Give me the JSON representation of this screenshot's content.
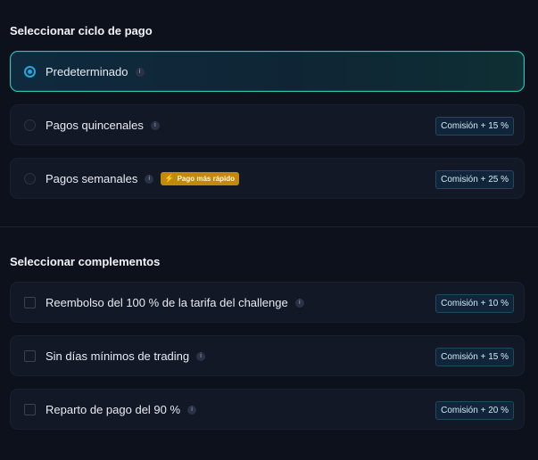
{
  "billing": {
    "title": "Seleccionar ciclo de pago",
    "options": [
      {
        "label": "Predeterminado",
        "selected": true,
        "badge": ""
      },
      {
        "label": "Pagos quincenales",
        "selected": false,
        "badge": "Comisión + 15 %"
      },
      {
        "label": "Pagos semanales",
        "selected": false,
        "badge": "Comisión + 25 %",
        "tag": "Pago más rápido"
      }
    ]
  },
  "addons": {
    "title": "Seleccionar complementos",
    "options": [
      {
        "label": "Reembolso del 100 % de la tarifa del challenge",
        "checked": false,
        "badge": "Comisión + 10 %"
      },
      {
        "label": "Sin días mínimos de trading",
        "checked": false,
        "badge": "Comisión + 15 %"
      },
      {
        "label": "Reparto de pago del 90 %",
        "checked": false,
        "badge": "Comisión + 20 %"
      }
    ]
  },
  "icons": {
    "info": "info-icon",
    "bolt": "lightning-bolt-icon"
  },
  "colors": {
    "accent": "#21a8e0",
    "selected_border": "#2bc8b6",
    "fast_tag": "#c18a0c",
    "background": "#0d111c"
  }
}
